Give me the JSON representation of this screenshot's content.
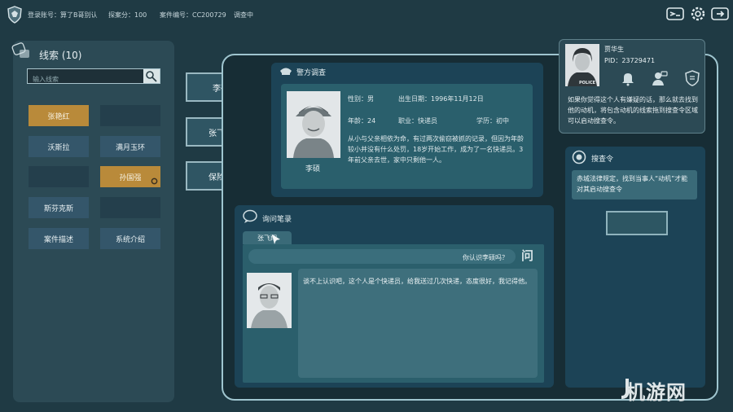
{
  "topbar": {
    "login_label": "登录账号：",
    "login_value": "算了B哥别认",
    "score_label": "探案分：",
    "score_value": "100",
    "case_label": "案件编号：",
    "case_value": "CC200729",
    "status": "调查中",
    "icons": [
      "id-card-icon",
      "settings-icon",
      "exit-icon"
    ]
  },
  "clues": {
    "title": "线索 (10)",
    "search_placeholder": "输入线索",
    "items": [
      {
        "label": "张艳红",
        "state": "active"
      },
      {
        "label": "",
        "state": "empty"
      },
      {
        "label": "沃斯拉",
        "state": "normal"
      },
      {
        "label": "满月玉环",
        "state": "normal"
      },
      {
        "label": "",
        "state": "empty"
      },
      {
        "label": "孙国强",
        "state": "active"
      },
      {
        "label": "斯芬克斯",
        "state": "normal"
      },
      {
        "label": "",
        "state": "empty"
      },
      {
        "label": "案件描述",
        "state": "normal"
      },
      {
        "label": "系统介绍",
        "state": "normal"
      }
    ]
  },
  "char_tabs": [
    "李硕",
    "张飞翔",
    "保险箱"
  ],
  "police": {
    "title": "警方调查",
    "name": "李硕",
    "gender": "性别：男",
    "birth": "出生日期：1996年11月12日",
    "age": "年龄：24",
    "job": "职业：快递员",
    "edu": "学历：初中",
    "desc": "从小与父亲相依为命，有过两次偷窃被抓的记录，但因为年龄较小并没有什么处罚，18岁开始工作，成为了一名快递员。3年前父亲去世，家中只剩他一人。"
  },
  "interrogation": {
    "title": "询问笔录",
    "tab": "张飞翔",
    "question": "你认识李硕吗？",
    "question_mark": "问",
    "answer": "谈不上认识吧，这个人是个快递员，给我送过几次快递，态度很好，我记得他。"
  },
  "suspect": {
    "name": "贾华生",
    "pid": "PID：23729471",
    "badge": "POLICE",
    "tip": "如果你觉得这个人有嫌疑的话，那么就去找到他的动机，将包含动机的线索拖到搜查令区域可以启动搜查令。"
  },
  "warrant": {
    "title": "搜查令",
    "note": "赤城法律规定，找到当事人“动机”才能对其启动搜查令"
  },
  "watermark": "机游网"
}
